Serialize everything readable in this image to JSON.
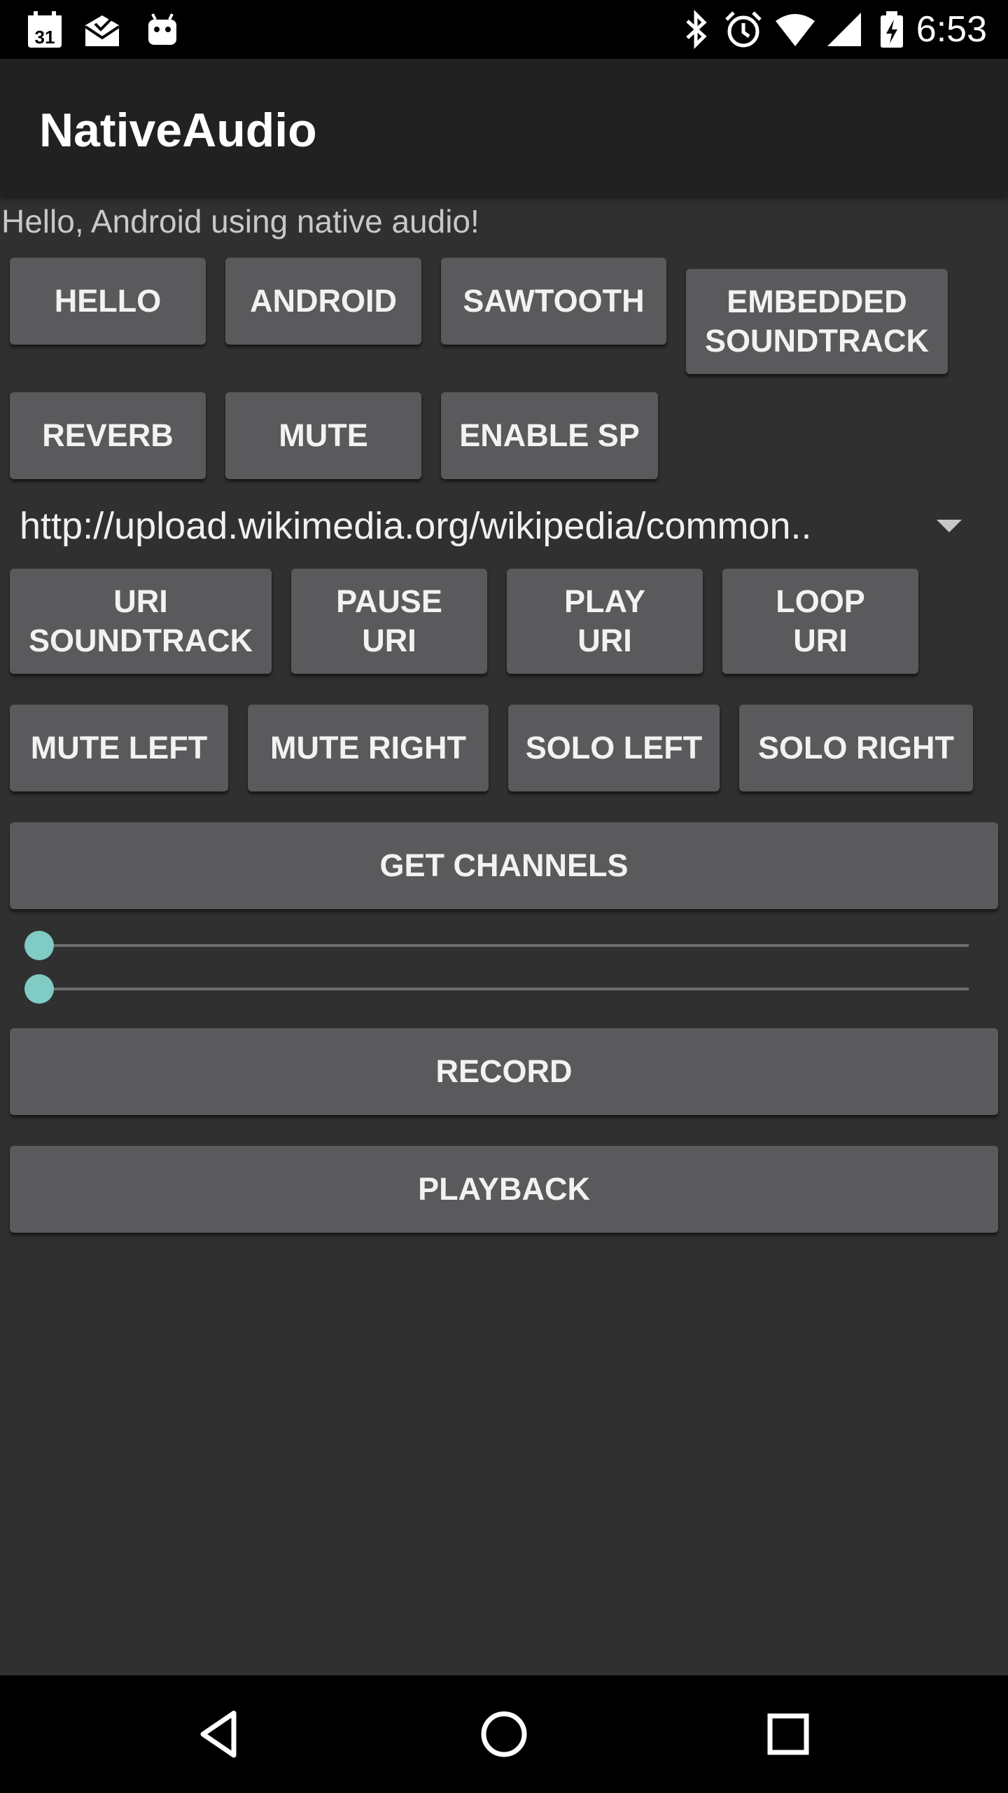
{
  "status_bar": {
    "time": "6:53",
    "left_icons": [
      "calendar-icon",
      "mail-icon",
      "android-icon"
    ],
    "calendar_day": "31",
    "right_icons": [
      "bluetooth-icon",
      "alarm-icon",
      "wifi-icon",
      "signal-icon",
      "battery-icon"
    ]
  },
  "app_bar": {
    "title": "NativeAudio"
  },
  "hello_text": "Hello, Android using native audio!",
  "buttons_row1": {
    "hello": "HELLO",
    "android": "ANDROID",
    "sawtooth": "SAWTOOTH",
    "embedded": "EMBEDDED\nSOUNDTRACK"
  },
  "buttons_row2": {
    "reverb": "REVERB",
    "mute": "MUTE",
    "enable_sp": "ENABLE SP"
  },
  "uri_spinner": {
    "value": "http://upload.wikimedia.org/wikipedia/common.."
  },
  "buttons_row3": {
    "uri_soundtrack": "URI\nSOUNDTRACK",
    "pause_uri": "PAUSE\nURI",
    "play_uri": "PLAY\nURI",
    "loop_uri": "LOOP\nURI"
  },
  "buttons_row4": {
    "mute_left": "MUTE LEFT",
    "mute_right": "MUTE RIGHT",
    "solo_left": "SOLO LEFT",
    "solo_right": "SOLO RIGHT"
  },
  "get_channels": "GET CHANNELS",
  "sliders": [
    {
      "value": 0
    },
    {
      "value": 0
    }
  ],
  "record": "RECORD",
  "playback": "PLAYBACK",
  "colors": {
    "background": "#303030",
    "app_bar": "#212121",
    "button": "#5a5a5c",
    "slider_accent": "#80cbc4"
  },
  "nav_bar": {
    "icons": [
      "back-icon",
      "home-icon",
      "recents-icon"
    ]
  }
}
